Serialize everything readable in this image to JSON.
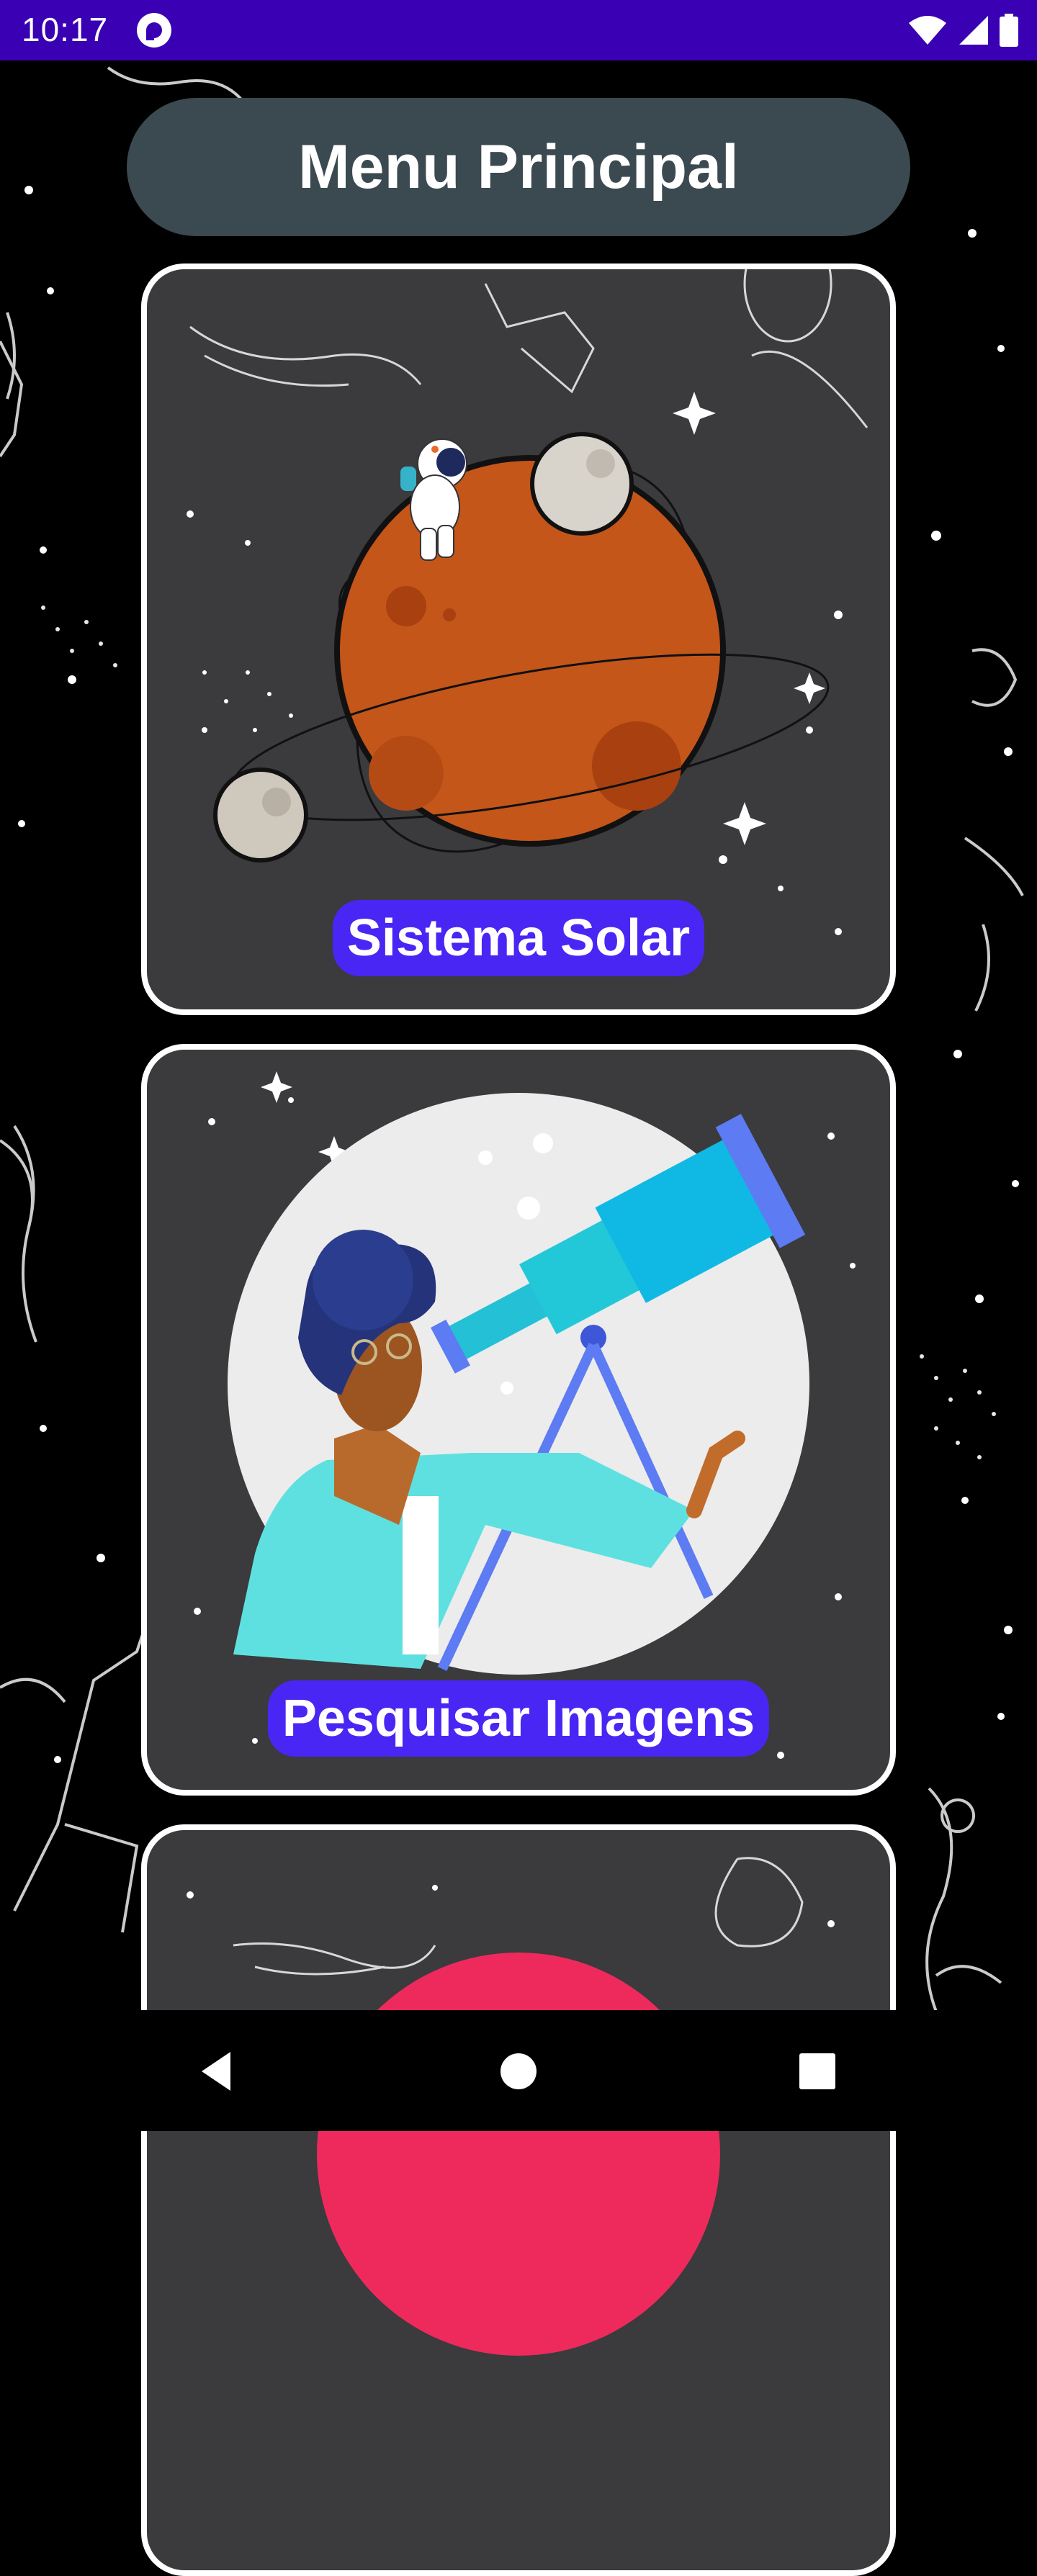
{
  "status_bar": {
    "time": "10:17",
    "app_icon": "pocket-casts-icon",
    "icons": [
      "wifi-icon",
      "signal-icon",
      "battery-icon"
    ],
    "background_color": "#3a00b4"
  },
  "header": {
    "title": "Menu Principal"
  },
  "cards": [
    {
      "label": "Sistema Solar",
      "illustration": "planet-with-astronaut-illustration"
    },
    {
      "label": "Pesquisar Imagens",
      "illustration": "woman-with-telescope-illustration"
    },
    {
      "label": "",
      "illustration": "red-planet-illustration"
    }
  ],
  "nav_bar": {
    "buttons": [
      "back-icon",
      "home-icon",
      "recents-icon"
    ]
  },
  "colors": {
    "card_background": "#3b3a3d",
    "label_background": "#4a26f4",
    "title_pill": "#3b4950"
  }
}
